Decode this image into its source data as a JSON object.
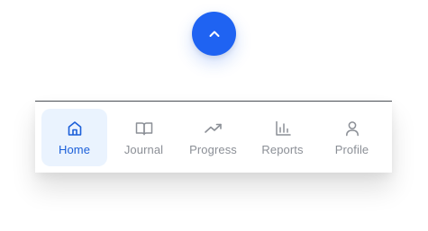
{
  "fab": {
    "icon": "chevron-up-icon",
    "color": "#1f63f2"
  },
  "nav": {
    "active_color": "#1b5fd9",
    "inactive_color": "#8b8f96",
    "active_bg": "#eaf3fe",
    "items": [
      {
        "label": "Home",
        "icon": "home-icon",
        "active": true
      },
      {
        "label": "Journal",
        "icon": "book-icon",
        "active": false
      },
      {
        "label": "Progress",
        "icon": "trending-up-icon",
        "active": false
      },
      {
        "label": "Reports",
        "icon": "bar-chart-icon",
        "active": false
      },
      {
        "label": "Profile",
        "icon": "user-icon",
        "active": false
      }
    ]
  }
}
